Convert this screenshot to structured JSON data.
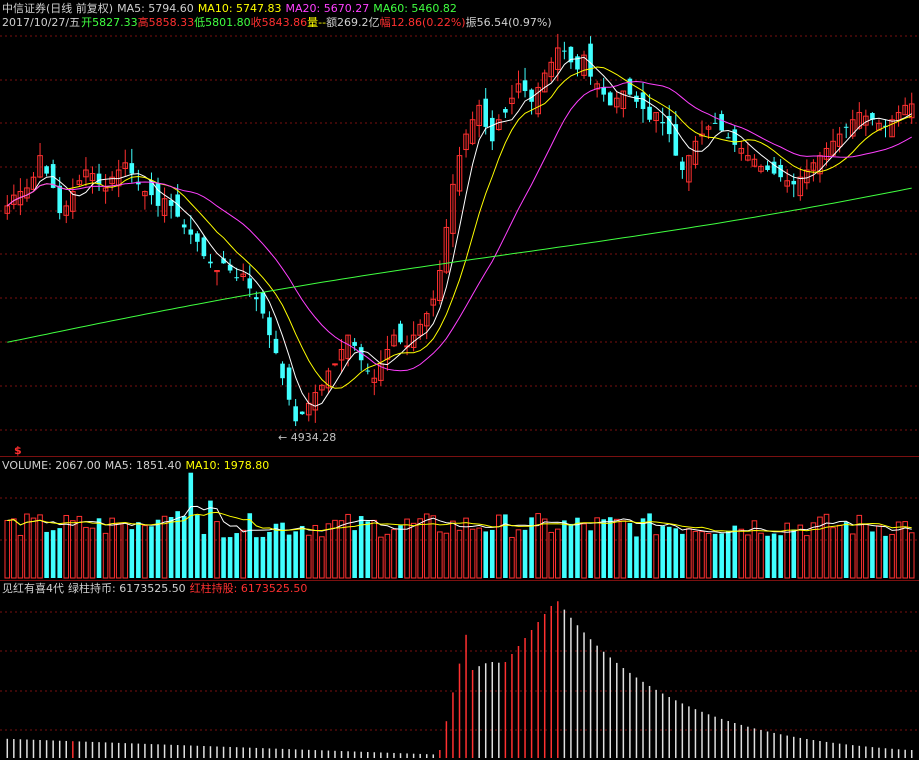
{
  "header": {
    "title": "中信证券(日线 前复权)",
    "ma5": "MA5: 5794.60",
    "ma10": "MA10: 5747.83",
    "ma20": "MA20: 5670.27",
    "ma60": "MA60: 5460.82",
    "date": "2017/10/27/五",
    "open_lbl": "开",
    "open_val": "5827.33",
    "high_lbl": "高",
    "high_val": "5858.33",
    "low_lbl": "低",
    "low_val": "5801.80",
    "close_lbl": "收",
    "close_val": "5843.86",
    "vol_lbl": "量--",
    "amt_lbl": "额269.2亿",
    "chg_lbl": "幅",
    "chg_val": "12.86(0.22%)",
    "amp": "振56.54(0.97%)"
  },
  "marker": "$",
  "low_annotation": "4934.28",
  "volume_header": {
    "vol": "VOLUME: 2067.00",
    "ma5": "MA5: 1851.40",
    "ma10": "MA10: 1978.80"
  },
  "indicator_header": {
    "name": "见红有喜4代",
    "green": "绿柱持币: 6173525.50",
    "red": "红柱持股: 6173525.50"
  },
  "colors": {
    "up": "#ff3030",
    "down": "#40ffff",
    "ma5": "#ffffff",
    "ma10": "#ffff00",
    "ma20": "#ff40ff",
    "ma60": "#40ff40",
    "grid": "#7a1010"
  },
  "chart_data": [
    {
      "type": "candlestick",
      "title": "中信证券(日线 前复权)",
      "ylim": [
        4880,
        6050
      ],
      "series_close": [
        5560,
        5590,
        5600,
        5610,
        5640,
        5700,
        5650,
        5610,
        5540,
        5560,
        5600,
        5630,
        5660,
        5650,
        5620,
        5610,
        5640,
        5660,
        5680,
        5650,
        5620,
        5600,
        5590,
        5560,
        5580,
        5560,
        5530,
        5500,
        5480,
        5460,
        5420,
        5400,
        5380,
        5400,
        5380,
        5360,
        5370,
        5330,
        5300,
        5260,
        5200,
        5150,
        5080,
        5020,
        4960,
        4980,
        5010,
        5040,
        5060,
        5100,
        5120,
        5160,
        5200,
        5170,
        5130,
        5100,
        5080,
        5120,
        5160,
        5200,
        5180,
        5170,
        5200,
        5230,
        5260,
        5300,
        5380,
        5500,
        5620,
        5700,
        5760,
        5800,
        5840,
        5780,
        5740,
        5800,
        5820,
        5860,
        5900,
        5880,
        5850,
        5890,
        5930,
        5960,
        6000,
        5990,
        5960,
        5940,
        5980,
        5920,
        5900,
        5870,
        5840,
        5860,
        5880,
        5870,
        5850,
        5830,
        5800,
        5820,
        5790,
        5760,
        5700,
        5660,
        5700,
        5740,
        5760,
        5780,
        5790,
        5770,
        5750,
        5730,
        5720,
        5700,
        5690,
        5670,
        5660,
        5650,
        5640,
        5630,
        5620,
        5640,
        5660,
        5680,
        5700,
        5720,
        5740,
        5760,
        5780,
        5800,
        5820,
        5810,
        5800,
        5790,
        5780,
        5800,
        5820,
        5840,
        5844
      ]
    },
    {
      "type": "bar",
      "title": "VOLUME",
      "ylim": [
        0,
        4000
      ]
    },
    {
      "type": "bar",
      "title": "见红有喜4代",
      "ylim": [
        0,
        1
      ]
    }
  ]
}
